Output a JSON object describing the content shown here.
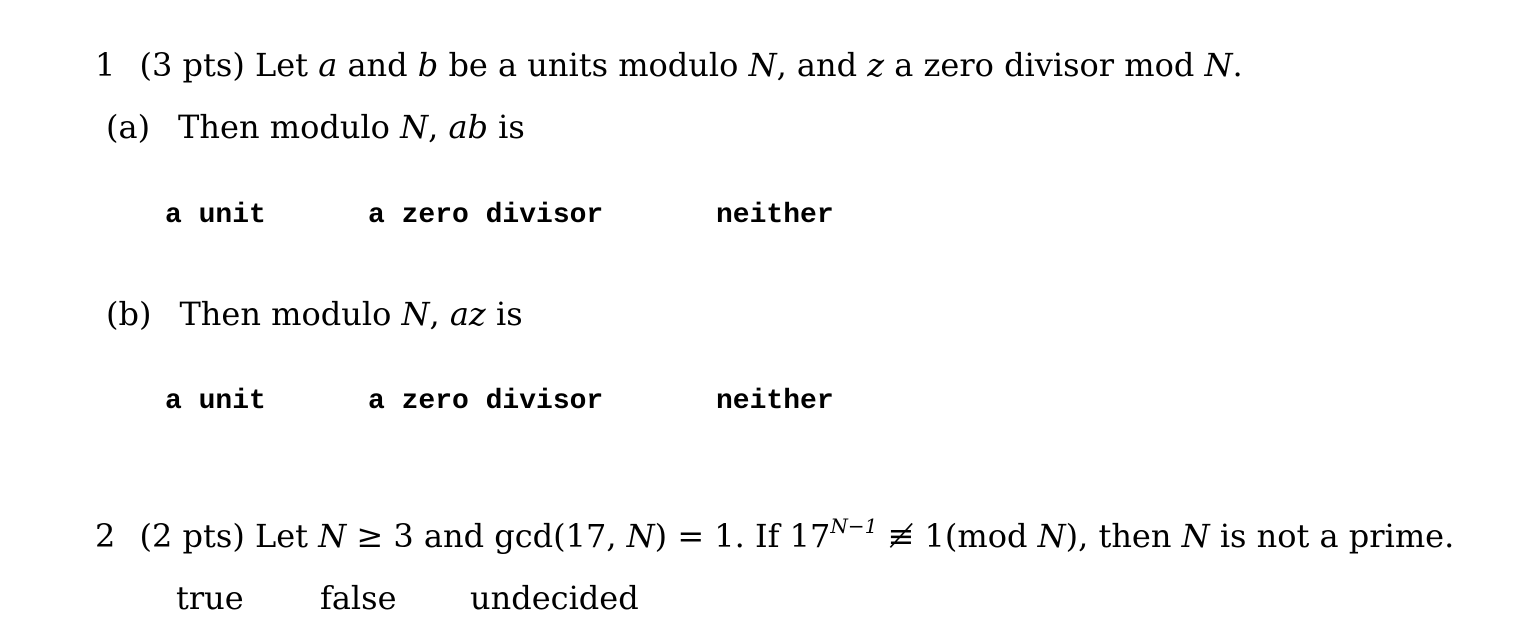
{
  "q1": {
    "number": "1",
    "points": "(3 pts)",
    "stem_parts": [
      "Let ",
      "a",
      " and ",
      "b",
      " be a units modulo ",
      "N",
      ", and ",
      "z",
      " a zero divisor mod ",
      "N",
      "."
    ],
    "parts": [
      {
        "label": "(a)",
        "text_pre": "Then modulo ",
        "var_N": "N",
        "comma": ", ",
        "expr": "ab",
        "text_post": " is",
        "options": [
          "a unit",
          "a zero divisor",
          "neither"
        ]
      },
      {
        "label": "(b)",
        "text_pre": "Then modulo ",
        "var_N": "N",
        "comma": ", ",
        "expr": "az",
        "text_post": " is",
        "options": [
          "a unit",
          "a zero divisor",
          "neither"
        ]
      }
    ]
  },
  "q2": {
    "number": "2",
    "points": "(2 pts)",
    "t1": "Let ",
    "N1": "N",
    "t2": " ≥ 3 and gcd(17, ",
    "N2": "N",
    "t3": ") = 1.  If 17",
    "exp": "N−1",
    "t4": " ≢ 1(mod ",
    "N3": "N",
    "t5": "), then ",
    "N4": "N",
    "t6": " is not a prime.",
    "options": [
      "true",
      "false",
      "undecided"
    ]
  }
}
